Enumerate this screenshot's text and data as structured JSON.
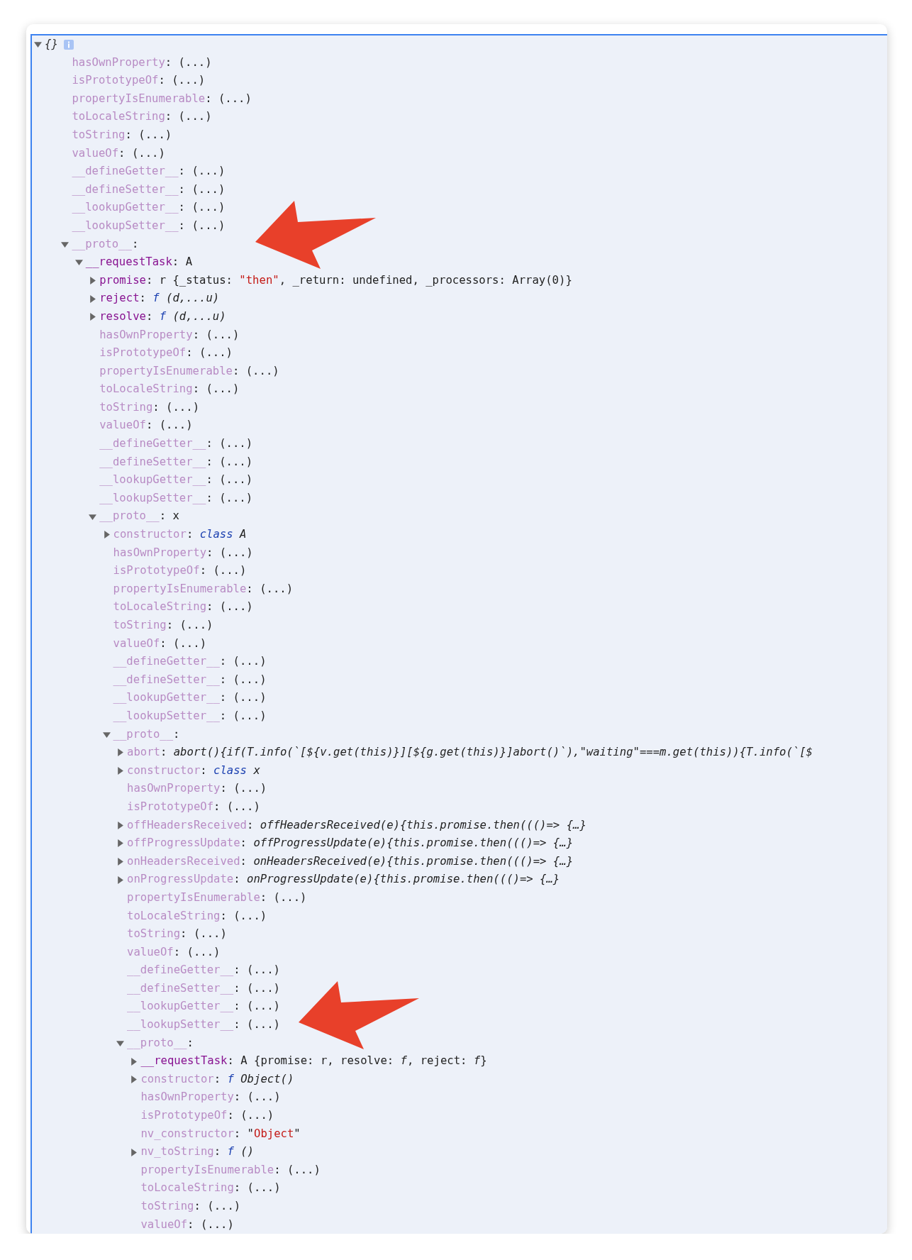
{
  "tree": {
    "key": "{}",
    "kind": "node",
    "expanded": true,
    "children": [
      {
        "key": "hasOwnProperty",
        "own": false,
        "kind": "leaf",
        "value": [
          {
            "kind": "plain",
            "text": ": (...)"
          }
        ]
      },
      {
        "key": "isPrototypeOf",
        "own": false,
        "kind": "leaf",
        "value": [
          {
            "kind": "plain",
            "text": ": (...)"
          }
        ]
      },
      {
        "key": "propertyIsEnumerable",
        "own": false,
        "kind": "leaf",
        "value": [
          {
            "kind": "plain",
            "text": ": (...)"
          }
        ]
      },
      {
        "key": "toLocaleString",
        "own": false,
        "kind": "leaf",
        "value": [
          {
            "kind": "plain",
            "text": ": (...)"
          }
        ]
      },
      {
        "key": "toString",
        "own": false,
        "kind": "leaf",
        "value": [
          {
            "kind": "plain",
            "text": ": (...)"
          }
        ]
      },
      {
        "key": "valueOf",
        "own": false,
        "kind": "leaf",
        "value": [
          {
            "kind": "plain",
            "text": ": (...)"
          }
        ]
      },
      {
        "key": "__defineGetter__",
        "own": false,
        "kind": "leaf",
        "value": [
          {
            "kind": "plain",
            "text": ": (...)"
          }
        ]
      },
      {
        "key": "__defineSetter__",
        "own": false,
        "kind": "leaf",
        "value": [
          {
            "kind": "plain",
            "text": ": (...)"
          }
        ]
      },
      {
        "key": "__lookupGetter__",
        "own": false,
        "kind": "leaf",
        "value": [
          {
            "kind": "plain",
            "text": ": (...)"
          }
        ]
      },
      {
        "key": "__lookupSetter__",
        "own": false,
        "kind": "leaf",
        "value": [
          {
            "kind": "plain",
            "text": ": (...)"
          }
        ]
      },
      {
        "key": "__proto__",
        "own": false,
        "kind": "node",
        "expanded": true,
        "value": [
          {
            "kind": "plain",
            "text": ":"
          }
        ],
        "children": [
          {
            "key": "__requestTask",
            "own": true,
            "kind": "node",
            "expanded": true,
            "value": [
              {
                "kind": "plain",
                "text": ": A"
              }
            ],
            "children": [
              {
                "key": "promise",
                "own": true,
                "kind": "node",
                "expanded": false,
                "value": [
                  {
                    "kind": "plain",
                    "text": ": r {_status: "
                  },
                  {
                    "kind": "string",
                    "text": "\"then\""
                  },
                  {
                    "kind": "plain",
                    "text": ", _return: undefined, _processors: Array(0)}"
                  }
                ]
              },
              {
                "key": "reject",
                "own": true,
                "kind": "node",
                "expanded": false,
                "value": [
                  {
                    "kind": "plain",
                    "text": ": "
                  },
                  {
                    "kind": "keyword",
                    "text": "f"
                  },
                  {
                    "kind": "code",
                    "text": " (d,...u)"
                  }
                ]
              },
              {
                "key": "resolve",
                "own": true,
                "kind": "node",
                "expanded": false,
                "value": [
                  {
                    "kind": "plain",
                    "text": ": "
                  },
                  {
                    "kind": "keyword",
                    "text": "f"
                  },
                  {
                    "kind": "code",
                    "text": " (d,...u)"
                  }
                ]
              },
              {
                "key": "hasOwnProperty",
                "own": false,
                "kind": "leaf",
                "value": [
                  {
                    "kind": "plain",
                    "text": ": (...)"
                  }
                ]
              },
              {
                "key": "isPrototypeOf",
                "own": false,
                "kind": "leaf",
                "value": [
                  {
                    "kind": "plain",
                    "text": ": (...)"
                  }
                ]
              },
              {
                "key": "propertyIsEnumerable",
                "own": false,
                "kind": "leaf",
                "value": [
                  {
                    "kind": "plain",
                    "text": ": (...)"
                  }
                ]
              },
              {
                "key": "toLocaleString",
                "own": false,
                "kind": "leaf",
                "value": [
                  {
                    "kind": "plain",
                    "text": ": (...)"
                  }
                ]
              },
              {
                "key": "toString",
                "own": false,
                "kind": "leaf",
                "value": [
                  {
                    "kind": "plain",
                    "text": ": (...)"
                  }
                ]
              },
              {
                "key": "valueOf",
                "own": false,
                "kind": "leaf",
                "value": [
                  {
                    "kind": "plain",
                    "text": ": (...)"
                  }
                ]
              },
              {
                "key": "__defineGetter__",
                "own": false,
                "kind": "leaf",
                "value": [
                  {
                    "kind": "plain",
                    "text": ": (...)"
                  }
                ]
              },
              {
                "key": "__defineSetter__",
                "own": false,
                "kind": "leaf",
                "value": [
                  {
                    "kind": "plain",
                    "text": ": (...)"
                  }
                ]
              },
              {
                "key": "__lookupGetter__",
                "own": false,
                "kind": "leaf",
                "value": [
                  {
                    "kind": "plain",
                    "text": ": (...)"
                  }
                ]
              },
              {
                "key": "__lookupSetter__",
                "own": false,
                "kind": "leaf",
                "value": [
                  {
                    "kind": "plain",
                    "text": ": (...)"
                  }
                ]
              },
              {
                "key": "__proto__",
                "own": false,
                "kind": "node",
                "expanded": true,
                "value": [
                  {
                    "kind": "plain",
                    "text": ": x"
                  }
                ],
                "children": [
                  {
                    "key": "constructor",
                    "own": false,
                    "kind": "node",
                    "expanded": false,
                    "value": [
                      {
                        "kind": "plain",
                        "text": ": "
                      },
                      {
                        "kind": "keyword",
                        "text": "class"
                      },
                      {
                        "kind": "code",
                        "text": " A"
                      }
                    ]
                  },
                  {
                    "key": "hasOwnProperty",
                    "own": false,
                    "kind": "leaf",
                    "value": [
                      {
                        "kind": "plain",
                        "text": ": (...)"
                      }
                    ]
                  },
                  {
                    "key": "isPrototypeOf",
                    "own": false,
                    "kind": "leaf",
                    "value": [
                      {
                        "kind": "plain",
                        "text": ": (...)"
                      }
                    ]
                  },
                  {
                    "key": "propertyIsEnumerable",
                    "own": false,
                    "kind": "leaf",
                    "value": [
                      {
                        "kind": "plain",
                        "text": ": (...)"
                      }
                    ]
                  },
                  {
                    "key": "toLocaleString",
                    "own": false,
                    "kind": "leaf",
                    "value": [
                      {
                        "kind": "plain",
                        "text": ": (...)"
                      }
                    ]
                  },
                  {
                    "key": "toString",
                    "own": false,
                    "kind": "leaf",
                    "value": [
                      {
                        "kind": "plain",
                        "text": ": (...)"
                      }
                    ]
                  },
                  {
                    "key": "valueOf",
                    "own": false,
                    "kind": "leaf",
                    "value": [
                      {
                        "kind": "plain",
                        "text": ": (...)"
                      }
                    ]
                  },
                  {
                    "key": "__defineGetter__",
                    "own": false,
                    "kind": "leaf",
                    "value": [
                      {
                        "kind": "plain",
                        "text": ": (...)"
                      }
                    ]
                  },
                  {
                    "key": "__defineSetter__",
                    "own": false,
                    "kind": "leaf",
                    "value": [
                      {
                        "kind": "plain",
                        "text": ": (...)"
                      }
                    ]
                  },
                  {
                    "key": "__lookupGetter__",
                    "own": false,
                    "kind": "leaf",
                    "value": [
                      {
                        "kind": "plain",
                        "text": ": (...)"
                      }
                    ]
                  },
                  {
                    "key": "__lookupSetter__",
                    "own": false,
                    "kind": "leaf",
                    "value": [
                      {
                        "kind": "plain",
                        "text": ": (...)"
                      }
                    ]
                  },
                  {
                    "key": "__proto__",
                    "own": false,
                    "kind": "node",
                    "expanded": true,
                    "value": [
                      {
                        "kind": "plain",
                        "text": ":"
                      }
                    ],
                    "children": [
                      {
                        "key": "abort",
                        "own": false,
                        "kind": "node",
                        "expanded": false,
                        "value": [
                          {
                            "kind": "plain",
                            "text": ": "
                          },
                          {
                            "kind": "code",
                            "text": "abort(){if(T.info(`[${v.get(this)}][${g.get(this)}]abort()`),\"waiting\"===m.get(this)){T.info(`[$"
                          }
                        ]
                      },
                      {
                        "key": "constructor",
                        "own": false,
                        "kind": "node",
                        "expanded": false,
                        "value": [
                          {
                            "kind": "plain",
                            "text": ": "
                          },
                          {
                            "kind": "keyword",
                            "text": "class"
                          },
                          {
                            "kind": "code",
                            "text": " x"
                          }
                        ]
                      },
                      {
                        "key": "hasOwnProperty",
                        "own": false,
                        "kind": "leaf",
                        "value": [
                          {
                            "kind": "plain",
                            "text": ": (...)"
                          }
                        ]
                      },
                      {
                        "key": "isPrototypeOf",
                        "own": false,
                        "kind": "leaf",
                        "value": [
                          {
                            "kind": "plain",
                            "text": ": (...)"
                          }
                        ]
                      },
                      {
                        "key": "offHeadersReceived",
                        "own": false,
                        "kind": "node",
                        "expanded": false,
                        "value": [
                          {
                            "kind": "plain",
                            "text": ": "
                          },
                          {
                            "kind": "code",
                            "text": "offHeadersReceived(e){this.promise.then((()=> {…}"
                          }
                        ]
                      },
                      {
                        "key": "offProgressUpdate",
                        "own": false,
                        "kind": "node",
                        "expanded": false,
                        "value": [
                          {
                            "kind": "plain",
                            "text": ": "
                          },
                          {
                            "kind": "code",
                            "text": "offProgressUpdate(e){this.promise.then((()=> {…}"
                          }
                        ]
                      },
                      {
                        "key": "onHeadersReceived",
                        "own": false,
                        "kind": "node",
                        "expanded": false,
                        "value": [
                          {
                            "kind": "plain",
                            "text": ": "
                          },
                          {
                            "kind": "code",
                            "text": "onHeadersReceived(e){this.promise.then((()=> {…}"
                          }
                        ]
                      },
                      {
                        "key": "onProgressUpdate",
                        "own": false,
                        "kind": "node",
                        "expanded": false,
                        "value": [
                          {
                            "kind": "plain",
                            "text": ": "
                          },
                          {
                            "kind": "code",
                            "text": "onProgressUpdate(e){this.promise.then((()=> {…}"
                          }
                        ]
                      },
                      {
                        "key": "propertyIsEnumerable",
                        "own": false,
                        "kind": "leaf",
                        "value": [
                          {
                            "kind": "plain",
                            "text": ": (...)"
                          }
                        ]
                      },
                      {
                        "key": "toLocaleString",
                        "own": false,
                        "kind": "leaf",
                        "value": [
                          {
                            "kind": "plain",
                            "text": ": (...)"
                          }
                        ]
                      },
                      {
                        "key": "toString",
                        "own": false,
                        "kind": "leaf",
                        "value": [
                          {
                            "kind": "plain",
                            "text": ": (...)"
                          }
                        ]
                      },
                      {
                        "key": "valueOf",
                        "own": false,
                        "kind": "leaf",
                        "value": [
                          {
                            "kind": "plain",
                            "text": ": (...)"
                          }
                        ]
                      },
                      {
                        "key": "__defineGetter__",
                        "own": false,
                        "kind": "leaf",
                        "value": [
                          {
                            "kind": "plain",
                            "text": ": (...)"
                          }
                        ]
                      },
                      {
                        "key": "__defineSetter__",
                        "own": false,
                        "kind": "leaf",
                        "value": [
                          {
                            "kind": "plain",
                            "text": ": (...)"
                          }
                        ]
                      },
                      {
                        "key": "__lookupGetter__",
                        "own": false,
                        "kind": "leaf",
                        "value": [
                          {
                            "kind": "plain",
                            "text": ": (...)"
                          }
                        ]
                      },
                      {
                        "key": "__lookupSetter__",
                        "own": false,
                        "kind": "leaf",
                        "value": [
                          {
                            "kind": "plain",
                            "text": ": (...)"
                          }
                        ]
                      },
                      {
                        "key": "__proto__",
                        "own": false,
                        "kind": "node",
                        "expanded": true,
                        "value": [
                          {
                            "kind": "plain",
                            "text": ":"
                          }
                        ],
                        "children": [
                          {
                            "key": "__requestTask",
                            "own": true,
                            "kind": "node",
                            "expanded": false,
                            "value": [
                              {
                                "kind": "plain",
                                "text": ": A {promise: r, resolve: "
                              },
                              {
                                "kind": "code",
                                "text": "f"
                              },
                              {
                                "kind": "plain",
                                "text": ", reject: "
                              },
                              {
                                "kind": "code",
                                "text": "f"
                              },
                              {
                                "kind": "plain",
                                "text": "}"
                              }
                            ]
                          },
                          {
                            "key": "constructor",
                            "own": false,
                            "kind": "node",
                            "expanded": false,
                            "value": [
                              {
                                "kind": "plain",
                                "text": ": "
                              },
                              {
                                "kind": "keyword",
                                "text": "f"
                              },
                              {
                                "kind": "code",
                                "text": " Object()"
                              }
                            ]
                          },
                          {
                            "key": "hasOwnProperty",
                            "own": false,
                            "kind": "leaf",
                            "value": [
                              {
                                "kind": "plain",
                                "text": ": (...)"
                              }
                            ]
                          },
                          {
                            "key": "isPrototypeOf",
                            "own": false,
                            "kind": "leaf",
                            "value": [
                              {
                                "kind": "plain",
                                "text": ": (...)"
                              }
                            ]
                          },
                          {
                            "key": "nv_constructor",
                            "own": false,
                            "kind": "leaf",
                            "value": [
                              {
                                "kind": "plain",
                                "text": ": \""
                              },
                              {
                                "kind": "string",
                                "text": "Object"
                              },
                              {
                                "kind": "plain",
                                "text": "\""
                              }
                            ]
                          },
                          {
                            "key": "nv_toString",
                            "own": false,
                            "kind": "node",
                            "expanded": false,
                            "value": [
                              {
                                "kind": "plain",
                                "text": ": "
                              },
                              {
                                "kind": "keyword",
                                "text": "f"
                              },
                              {
                                "kind": "code",
                                "text": " ()"
                              }
                            ]
                          },
                          {
                            "key": "propertyIsEnumerable",
                            "own": false,
                            "kind": "leaf",
                            "value": [
                              {
                                "kind": "plain",
                                "text": ": (...)"
                              }
                            ]
                          },
                          {
                            "key": "toLocaleString",
                            "own": false,
                            "kind": "leaf",
                            "value": [
                              {
                                "kind": "plain",
                                "text": ": (...)"
                              }
                            ]
                          },
                          {
                            "key": "toString",
                            "own": false,
                            "kind": "leaf",
                            "value": [
                              {
                                "kind": "plain",
                                "text": ": (...)"
                              }
                            ]
                          },
                          {
                            "key": "valueOf",
                            "own": false,
                            "kind": "leaf",
                            "value": [
                              {
                                "kind": "plain",
                                "text": ": (...)"
                              }
                            ]
                          }
                        ]
                      }
                    ]
                  }
                ]
              }
            ]
          }
        ]
      }
    ]
  },
  "annotations": [
    {
      "kind": "arrow"
    },
    {
      "kind": "arrow"
    }
  ]
}
